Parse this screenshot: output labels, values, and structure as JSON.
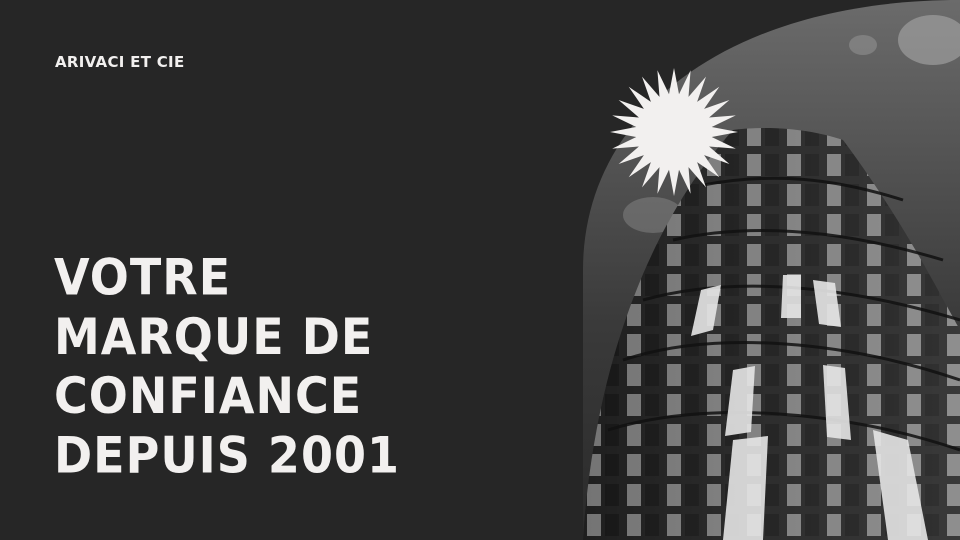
{
  "brand": {
    "name": "ARIVACI ET CIE"
  },
  "headline": {
    "lines": [
      "VOTRE",
      "MARQUE DE",
      "CONFIANCE",
      "DEPUIS 2001"
    ]
  },
  "decor": {
    "photo": "black-and-white tower",
    "burst": "starburst-icon"
  },
  "colors": {
    "background": "#262626",
    "text": "#f2f0ef"
  }
}
